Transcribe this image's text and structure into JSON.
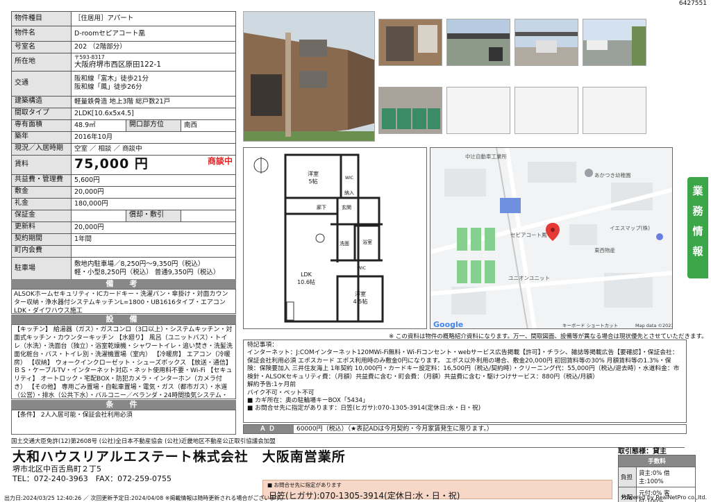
{
  "doc_id": "6427551",
  "property": {
    "rows": [
      {
        "k": "物件種目",
        "v": "［住居用］アパート"
      },
      {
        "k": "物件名",
        "v": "D-roomセピアコート凰"
      },
      {
        "k": "号室名",
        "v": "202 （2階部分）"
      },
      {
        "k": "所在地",
        "v1": "〒593-8317",
        "v2": "大阪府堺市西区原田122-1"
      },
      {
        "k": "交通",
        "v1": "阪和線「富木」徒歩21分",
        "v2": "阪和線「鳳」徒歩26分"
      },
      {
        "k": "建築構造",
        "v": "軽量鉄骨造 地上3階 総戸数21戸"
      },
      {
        "k": "間取タイプ",
        "v": "2LDK[10.6x5x4.5]"
      },
      {
        "k": "専有面積",
        "v": "48.9㎡",
        "k2": "開口部方位",
        "v2": "南西"
      },
      {
        "k": "築年",
        "v": "2016年10月"
      },
      {
        "k": "現況／入居時期",
        "v": "空室 ／ 相談 ／ 商談中"
      },
      {
        "k": "賃料",
        "v": "75,000 円",
        "badge": "商談中"
      },
      {
        "k": "共益費・管理費",
        "v": "5,600円"
      },
      {
        "k": "敷金",
        "v": "20,000円"
      },
      {
        "k": "礼金",
        "v": "180,000円"
      },
      {
        "k": "保証金",
        "v": "",
        "k2": "償却・敷引",
        "v2": ""
      },
      {
        "k": "更新料",
        "v": "20,000円"
      },
      {
        "k": "契約期間",
        "v": "1年間"
      },
      {
        "k": "町内会費",
        "v": ""
      },
      {
        "k": "駐車場",
        "v1": "敷地内駐車場／8,250円〜9,350円（税込）",
        "v2": "軽・小型8,250円（税込） 普通9,350円（税込）"
      }
    ]
  },
  "sections": {
    "bikou_title": "備　考",
    "bikou": "ALSOKホームセキュリティ・ICカードキー・洗濯パン・傘掛け・対面カウンター収納・浄水器付システムキッチンL=1800・UB1616タイプ・エアコンLDK・ダイワハウス施工",
    "setsubi_title": "設　備",
    "setsubi": "【キッチン】 給湯器（ガス）・ガスコンロ（3口以上）・システムキッチン・対面式キッチン・カウンターキッチン 【水廻り】 風呂（ユニットバス）・トイレ（水洗）・洗面台（独立）・浴室乾燥機・シャワートイレ・追い焚き・洗髪洗面化粧台・バス・トイレ別・洗濯機置場（室内） 【冷暖房】 エアコン（冷暖房） 【収納】 ウォークインクローゼット・シューズボックス 【放送・通信】 ＢＳ・ケーブルTV・インターネット対応・ネット使用料不要・Wi-Fi 【セキュリティ】 オートロック・宅配BOX・防犯カメラ・インターホン（カメラ付き） 【その他】 専用ごみ置場・自転車置場・電気・ガス（都市ガス）・水道（公営）・排水（公共下水）・バルコニー／ベランダ・24時間換気システム・フローリング・室内物干",
    "jouken_title": "条　件",
    "jouken": "【条件】 2人入居可能・保証会社利用必須"
  },
  "plan": {
    "rooms": {
      "yoshitsu1": "洋室\n5帖",
      "wic1": "ウォークインクローゼット",
      "nyuka": "納入",
      "rouka": "廊下",
      "genkan": "玄関",
      "ldk": "LDK\n10.6帖",
      "senmen": "洗面",
      "yokushitsu": "浴室",
      "wic2": "ウォークインクローゼット",
      "yoshitsu2": "洋室\n4.5帖"
    }
  },
  "map": {
    "labels": {
      "top": "中辻自動車工業所",
      "kinder": "あかつき幼稚園",
      "property": "セピアコート鳳",
      "iesmap": "イエスマップ(株)",
      "higashi": "東西物産",
      "unit": "ユニオンユニット"
    },
    "brand": "Google",
    "shortcut": "キーボード ショートカット",
    "credit": "Map data ©2023"
  },
  "disclaimer": "※ この資料は物件の概略紹介資料になります。万一、間取図面、設備等が異なる場合は現状優先とさせていただきます。",
  "remarks": {
    "title": "特記事項：",
    "lines": [
      "インターネット：J:COMインターネット120MWi-Fi無料・Wi-Fiコンセント・webサービス広告掲載【許可】・チラシ、雑誌等掲載広告【要確認】・保証会社：保証会社利用必須 エポスカード エポス利用時のみ敷金0円になります。 エポス以外利用の場合、敷金20,000円 初回賃料等の30% 月額賃料等の1.3%・保険：保険要加入 三井住友海上 1年契約 10,000円・カードキー設定料：16,500円（税込/契約時）・クリーニング代：55,000円（税込/退去時）・水道料金：市検針・ALSOKセキュリティ費：（月額）共益費に含む・町会費：（月額）共益費に含む・駆けつけサービス：880円（税込/月額）",
      "解約予告:1ヶ月前",
      "バイク不可・ペット不可",
      "■ カギ所在：奥の駐輪場キーBOX「5434」",
      "■ お問合せ先に指定があります：日笠(ヒガサ):070-1305-3914(定休日:水・日・祝)"
    ]
  },
  "ad": {
    "label": "ＡＤ",
    "value": "60000円（税込）（★表記ADは今月契約・今月家賃発生に限ります。）"
  },
  "sidetab": [
    "業",
    "務",
    "情",
    "報"
  ],
  "footer": {
    "assoc": "国土交通大臣免許(12)第2608号 (公社)全日本不動産協会 (公社)近畿地区不動産公正取引協議会加盟",
    "company": "大和ハウスリアルエステート株式会社　大阪南営業所",
    "address": "堺市北区中百舌鳥町２丁5",
    "tel": "TEL：072-240-3963　FAX：072-259-0755",
    "torihiki": "取引態様：貸主",
    "fee_title": "手数料",
    "fees": [
      {
        "k": "負担",
        "v": "貸主:0% 借主:100%"
      },
      {
        "k": "分配",
        "v": "元付:0% 客付:100%"
      }
    ],
    "contact_small": "■ お問合せ先に指定があります",
    "contact_big": "日笠(ヒガサ):070-1305-3914(定休日:水・日・祝)",
    "dates": "出力日:2024/03/25 12:40:26 ／ 次回更新予定日:2024/04/08 ※掲載情報は随時更新される場合がございます。",
    "powered": "Powered by RealNetPro co.,ltd."
  }
}
